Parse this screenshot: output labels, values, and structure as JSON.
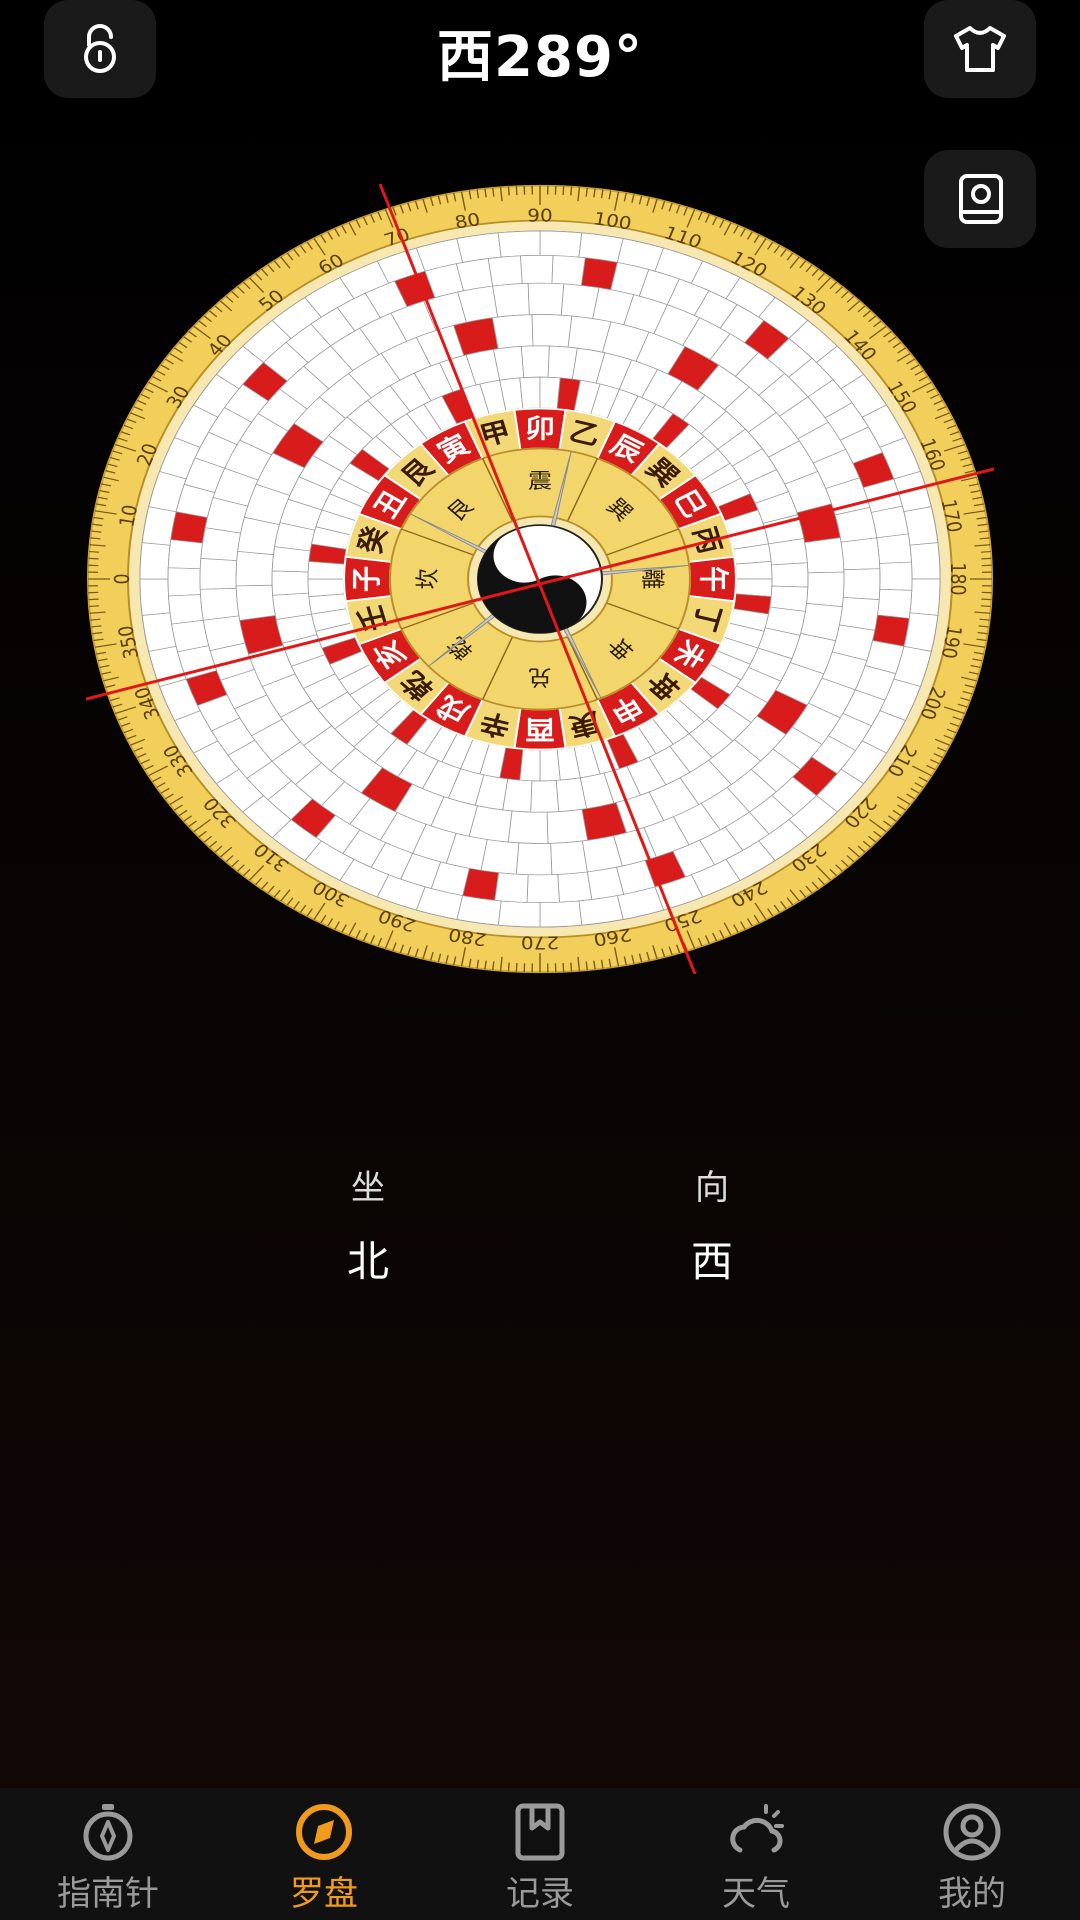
{
  "header": {
    "title": "西289°"
  },
  "compass": {
    "degree_labels": [
      "0",
      "10",
      "20",
      "30",
      "40",
      "50",
      "60",
      "70",
      "80",
      "90",
      "100",
      "110",
      "120",
      "130",
      "140",
      "150",
      "160",
      "170",
      "180",
      "190",
      "200",
      "210",
      "220",
      "230",
      "240",
      "250",
      "260",
      "270",
      "280",
      "290",
      "300",
      "310",
      "320",
      "330",
      "340",
      "350"
    ],
    "mountains": [
      "子",
      "癸",
      "丑",
      "艮",
      "寅",
      "甲",
      "卯",
      "乙",
      "辰",
      "巽",
      "巳",
      "丙",
      "午",
      "丁",
      "未",
      "坤",
      "申",
      "庚",
      "酉",
      "辛",
      "戌",
      "乾",
      "亥",
      "壬"
    ],
    "trigrams": [
      "坎",
      "艮",
      "震",
      "巽",
      "離",
      "坤",
      "兑",
      "乾"
    ],
    "colors": {
      "ring_gold": "#f2cf5a",
      "red": "#d81c1c",
      "cell_white": "#ffffff"
    }
  },
  "position": {
    "sit_label": "坐",
    "sit_value": "北",
    "face_label": "向",
    "face_value": "西"
  },
  "tabs": [
    {
      "label": "指南针",
      "icon": "compass-icon"
    },
    {
      "label": "罗盘",
      "icon": "luopan-icon"
    },
    {
      "label": "记录",
      "icon": "bookmark-icon"
    },
    {
      "label": "天气",
      "icon": "weather-icon"
    },
    {
      "label": "我的",
      "icon": "profile-icon"
    }
  ],
  "active_tab": 1
}
